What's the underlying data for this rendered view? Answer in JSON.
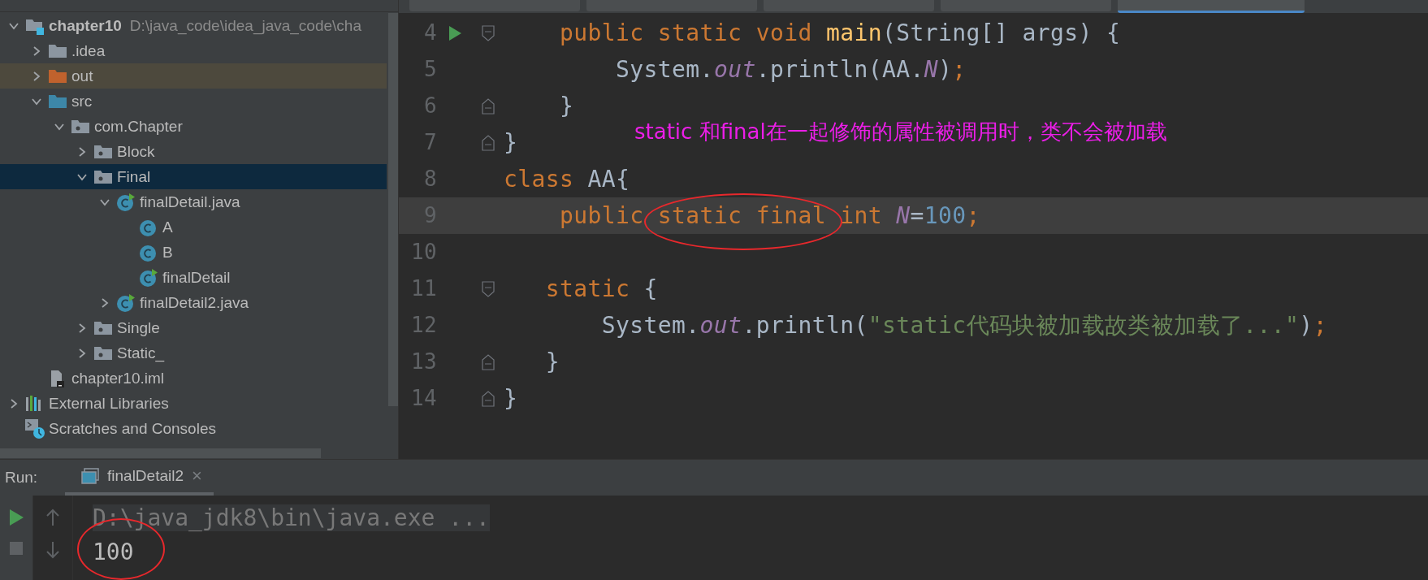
{
  "sidebar": {
    "tree": [
      {
        "label": "chapter10",
        "path": "D:\\java_code\\idea_java_code\\cha",
        "kind": "module",
        "expanded": true,
        "selected": false,
        "children": [
          {
            "label": ".idea",
            "kind": "folder",
            "expanded": false,
            "selected": false
          },
          {
            "label": "out",
            "kind": "excluded-folder",
            "expanded": false,
            "selected": false
          },
          {
            "label": "src",
            "kind": "source-folder",
            "expanded": true,
            "selected": false,
            "children": [
              {
                "label": "com.Chapter",
                "kind": "package",
                "expanded": true,
                "selected": false,
                "children": [
                  {
                    "label": "Block",
                    "kind": "package",
                    "expanded": false,
                    "selected": false
                  },
                  {
                    "label": "Final",
                    "kind": "package",
                    "expanded": true,
                    "selected": true,
                    "children": [
                      {
                        "label": "finalDetail.java",
                        "kind": "java-file",
                        "expanded": true,
                        "selected": false,
                        "children": [
                          {
                            "label": "A",
                            "kind": "class",
                            "selected": false
                          },
                          {
                            "label": "B",
                            "kind": "class",
                            "selected": false
                          },
                          {
                            "label": "finalDetail",
                            "kind": "main-class",
                            "selected": false
                          }
                        ]
                      },
                      {
                        "label": "finalDetail2.java",
                        "kind": "java-file",
                        "expanded": false,
                        "selected": false
                      }
                    ]
                  },
                  {
                    "label": "Single",
                    "kind": "package",
                    "expanded": false,
                    "selected": false
                  },
                  {
                    "label": "Static_",
                    "kind": "package",
                    "expanded": false,
                    "selected": false
                  }
                ]
              }
            ]
          },
          {
            "label": "chapter10.iml",
            "kind": "iml",
            "selected": false
          }
        ]
      },
      {
        "label": "External Libraries",
        "kind": "libraries",
        "expanded": false,
        "selected": false
      },
      {
        "label": "Scratches and Consoles",
        "kind": "scratches",
        "selected": false
      }
    ]
  },
  "editor": {
    "tabs": [
      {
        "selected": false
      },
      {
        "selected": false
      },
      {
        "selected": false
      },
      {
        "selected": false
      },
      {
        "selected": true
      }
    ],
    "lines": [
      {
        "number": "4",
        "run": true,
        "fold_open": true,
        "fold_close": false,
        "current": false,
        "tokens": [
          {
            "text": "    public static void ",
            "kind": "keyword"
          },
          {
            "text": "main",
            "kind": "method"
          },
          {
            "text": "(String[] args) {",
            "kind": "plain"
          }
        ]
      },
      {
        "number": "5",
        "run": false,
        "fold_open": false,
        "fold_close": false,
        "current": false,
        "tokens": [
          {
            "text": "        System.",
            "kind": "plain"
          },
          {
            "text": "out",
            "kind": "field"
          },
          {
            "text": ".println(AA.",
            "kind": "plain"
          },
          {
            "text": "N",
            "kind": "field"
          },
          {
            "text": ")",
            "kind": "plain"
          },
          {
            "text": ";",
            "kind": "keyword"
          }
        ]
      },
      {
        "number": "6",
        "run": false,
        "fold_open": false,
        "fold_close": true,
        "current": false,
        "tokens": [
          {
            "text": "    }",
            "kind": "plain"
          }
        ]
      },
      {
        "number": "7",
        "run": false,
        "fold_open": false,
        "fold_close": true,
        "current": false,
        "tokens": [
          {
            "text": "}",
            "kind": "plain"
          }
        ]
      },
      {
        "number": "8",
        "run": false,
        "fold_open": false,
        "fold_close": false,
        "current": false,
        "tokens": [
          {
            "text": "class ",
            "kind": "keyword"
          },
          {
            "text": "AA{",
            "kind": "plain"
          }
        ]
      },
      {
        "number": "9",
        "run": false,
        "fold_open": false,
        "fold_close": false,
        "current": true,
        "tokens": [
          {
            "text": "    public static final int ",
            "kind": "keyword"
          },
          {
            "text": "N",
            "kind": "field"
          },
          {
            "text": "=",
            "kind": "plain"
          },
          {
            "text": "100",
            "kind": "number"
          },
          {
            "text": ";",
            "kind": "keyword"
          }
        ]
      },
      {
        "number": "10",
        "run": false,
        "fold_open": false,
        "fold_close": false,
        "current": false
      },
      {
        "number": "11",
        "run": false,
        "fold_open": true,
        "fold_close": false,
        "current": false,
        "tokens": [
          {
            "text": "   static ",
            "kind": "keyword"
          },
          {
            "text": "{",
            "kind": "plain"
          }
        ]
      },
      {
        "number": "12",
        "run": false,
        "fold_open": false,
        "fold_close": false,
        "current": false,
        "tokens": [
          {
            "text": "       System.",
            "kind": "plain"
          },
          {
            "text": "out",
            "kind": "field"
          },
          {
            "text": ".println(",
            "kind": "plain"
          },
          {
            "text": "\"static代码块被加载故类被加载了...\"",
            "kind": "string"
          },
          {
            "text": ")",
            "kind": "plain"
          },
          {
            "text": ";",
            "kind": "keyword"
          }
        ]
      },
      {
        "number": "13",
        "run": false,
        "fold_open": false,
        "fold_close": true,
        "current": false,
        "tokens": [
          {
            "text": "   }",
            "kind": "plain"
          }
        ]
      },
      {
        "number": "14",
        "run": false,
        "fold_open": false,
        "fold_close": true,
        "current": false,
        "tokens": [
          {
            "text": "}",
            "kind": "plain"
          }
        ]
      }
    ],
    "annotation": "static 和final在一起修饰的属性被调用时，类不会被加载"
  },
  "run_panel": {
    "label": "Run:",
    "tabs": [
      {
        "label": "finalDetail2",
        "close": "×",
        "selected": true
      }
    ],
    "output": [
      {
        "text": "D:\\java_jdk8\\bin\\java.exe ...",
        "kind": "command"
      },
      {
        "text": "100",
        "kind": "stdout"
      }
    ]
  }
}
